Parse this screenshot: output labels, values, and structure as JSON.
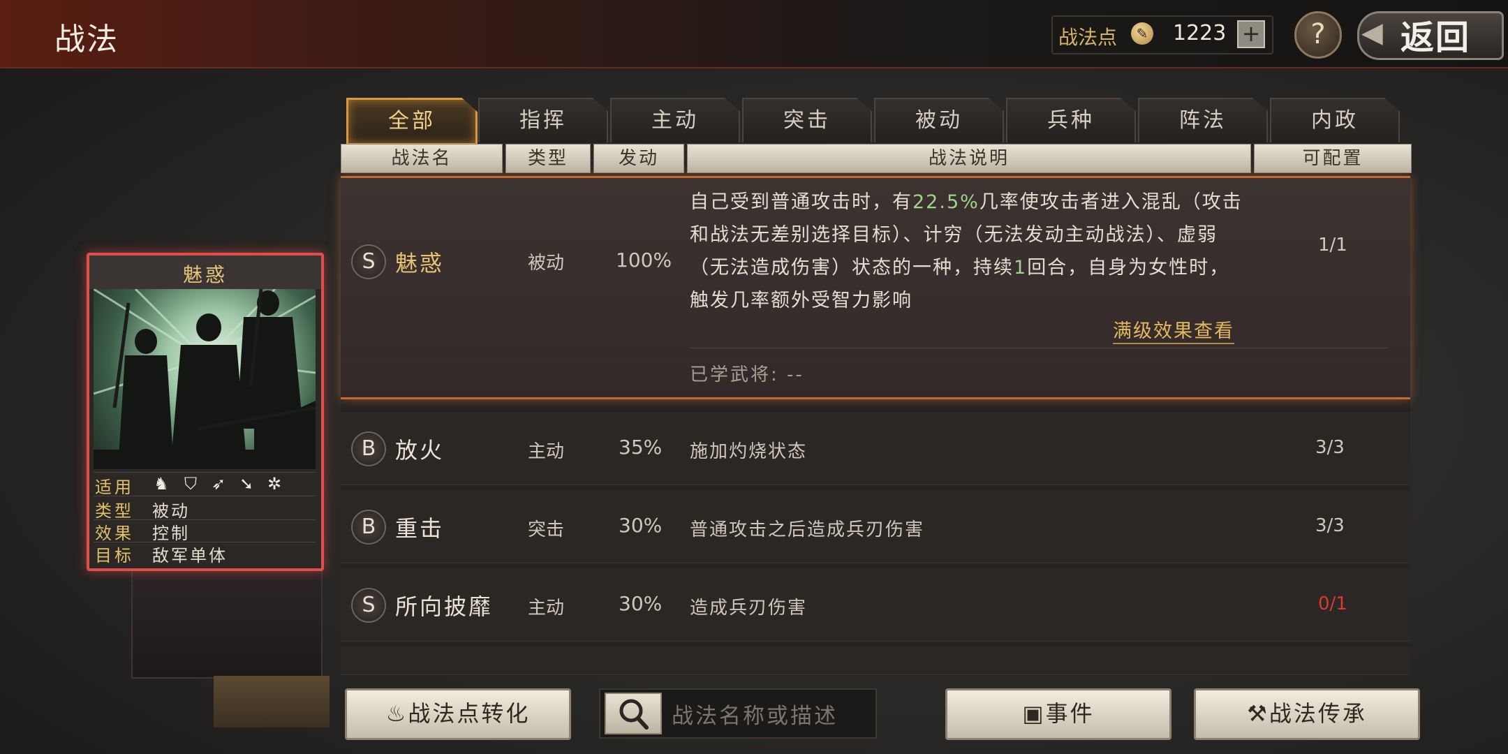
{
  "header": {
    "title": "战法",
    "points_label": "战法点",
    "points_value": "1223",
    "add_label": "+",
    "help_label": "?",
    "back_label": "返回"
  },
  "tabs": [
    {
      "label": "全部",
      "active": true
    },
    {
      "label": "指挥"
    },
    {
      "label": "主动"
    },
    {
      "label": "突击"
    },
    {
      "label": "被动"
    },
    {
      "label": "兵种"
    },
    {
      "label": "阵法"
    },
    {
      "label": "内政"
    }
  ],
  "table": {
    "headers": {
      "name": "战法名",
      "type": "类型",
      "trigger": "发动",
      "desc": "战法说明",
      "config": "可配置"
    }
  },
  "selected_skill": {
    "grade": "S",
    "name": "魅惑",
    "type": "被动",
    "rate": "100%",
    "desc_part1": "自己受到普通攻击时，有",
    "desc_highlight1": "22.5%",
    "desc_part2": "几率使攻击者进入混乱（攻击和战法无差别选择目标）、计穷（无法发动主动战法）、虚弱（无法造成伤害）状态的一种，持续",
    "desc_highlight2": "1",
    "desc_part3": "回合，自身为女性时，触发几率额外受智力影响",
    "max_link": "满级效果查看",
    "config": "1/1",
    "learned_label": "已学武将:",
    "learned_value": "--"
  },
  "skills": [
    {
      "grade": "B",
      "name": "放火",
      "type": "主动",
      "rate": "35%",
      "desc": "施加灼烧状态",
      "config": "3/3"
    },
    {
      "grade": "B",
      "name": "重击",
      "type": "突击",
      "rate": "30%",
      "desc": "普通攻击之后造成兵刃伤害",
      "config": "3/3"
    },
    {
      "grade": "S",
      "name": "所向披靡",
      "type": "主动",
      "rate": "30%",
      "desc": "造成兵刃伤害",
      "config": "0/1"
    }
  ],
  "card": {
    "title": "魅惑",
    "apply_label": "适用",
    "type_label": "类型",
    "type_value": "被动",
    "effect_label": "效果",
    "effect_value": "控制",
    "target_label": "目标",
    "target_value": "敌军单体",
    "troop_icons": [
      "cavalry-icon",
      "shield-icon",
      "bow-icon",
      "spear-icon",
      "chariot-icon"
    ]
  },
  "bottom": {
    "convert_label": "战法点转化",
    "search_placeholder": "战法名称或描述",
    "event_label": "事件",
    "inherit_label": "战法传承"
  },
  "colors": {
    "accent_gold": "#e5c372",
    "highlight_green": "#9fd48a",
    "warn_red": "#d83a2e",
    "select_orange": "#c46a30"
  }
}
